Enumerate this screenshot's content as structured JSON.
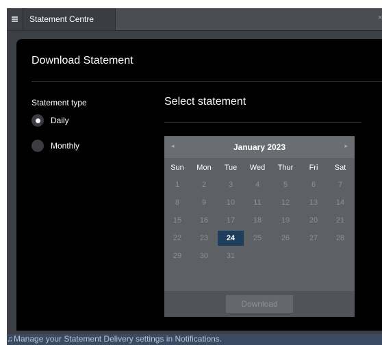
{
  "window": {
    "tab_label": "Statement Centre",
    "close_glyph": "×"
  },
  "panel": {
    "title": "Download Statement",
    "statement_type_label": "Statement type",
    "options": [
      {
        "label": "Daily",
        "selected": true
      },
      {
        "label": "Monthly",
        "selected": false
      }
    ],
    "select_title": "Select statement"
  },
  "calendar": {
    "month_label": "January 2023",
    "prev_glyph": "◂",
    "next_glyph": "▸",
    "weekdays": [
      "Sun",
      "Mon",
      "Tue",
      "Wed",
      "Thur",
      "Fri",
      "Sat"
    ],
    "days": [
      "1",
      "2",
      "3",
      "4",
      "5",
      "6",
      "7",
      "8",
      "9",
      "10",
      "11",
      "12",
      "13",
      "14",
      "15",
      "16",
      "17",
      "18",
      "19",
      "20",
      "21",
      "22",
      "23",
      "24",
      "25",
      "26",
      "27",
      "28",
      "29",
      "30",
      "31"
    ],
    "first_weekday_index": 0,
    "selected_day": "24",
    "download_label": "Download"
  },
  "notification": {
    "bell_glyph": "♫",
    "text": "Manage your Statement Delivery settings in Notifications."
  },
  "colors": {
    "selected_day": "#1f3e5e",
    "calendar_bg": "#5d6166",
    "panel_bg": "#000000",
    "notice_bg": "#3a4a60"
  },
  "icons": {
    "menu": "hamburger-icon",
    "bell": "bell-icon"
  }
}
